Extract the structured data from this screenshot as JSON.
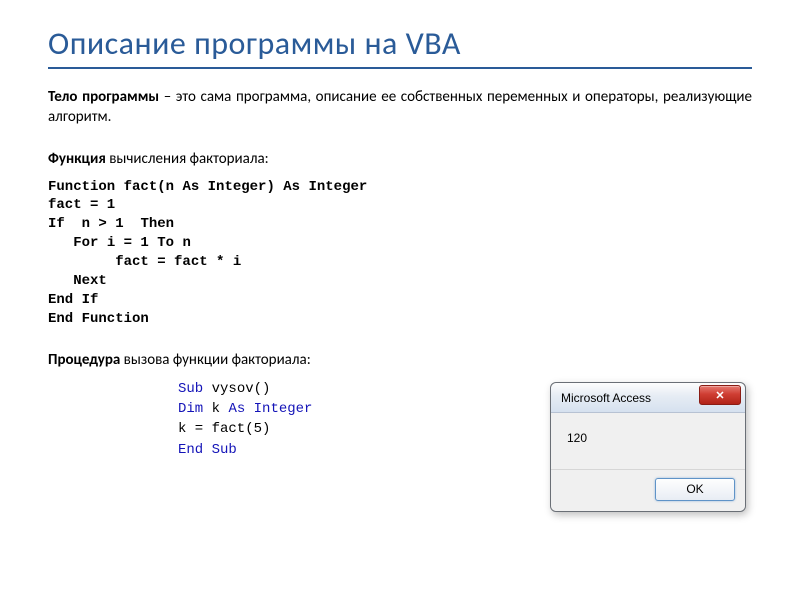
{
  "slide": {
    "title": "Описание программы на VBA",
    "intro_bold": "Тело программы",
    "intro_rest": " – это сама программа, описание ее собственных переменных и операторы, реализующие алгоритм.",
    "sub1_bold": "Функция",
    "sub1_rest": " вычисления факториала:",
    "code1_l1a": "Function",
    "code1_l1b": " fact(n ",
    "code1_l1c": "As Integer",
    "code1_l1d": ") ",
    "code1_l1e": "As Integer",
    "code1_l2": "fact = 1",
    "code1_l3a": "If",
    "code1_l3b": "  n > 1  ",
    "code1_l3c": "Then",
    "code1_l4a": "   For",
    "code1_l4b": " i = 1 ",
    "code1_l4c": "To",
    "code1_l4d": " n",
    "code1_l5": "        fact = fact * i",
    "code1_l6": "   Next",
    "code1_l7": "End If",
    "code1_l8": "End Function",
    "sub2_bold": "Процедура",
    "sub2_rest": " вызова функции факториала:",
    "code2_l1a": "Sub",
    "code2_l1b": " vysov()",
    "code2_l2a": "Dim",
    "code2_l2b": " k ",
    "code2_l2c": "As Integer",
    "code2_l3": "k = fact(5)",
    "code2_l4": "End Sub"
  },
  "dialog": {
    "title": "Microsoft Access",
    "close_glyph": "✕",
    "body": "120",
    "ok": "OK"
  }
}
